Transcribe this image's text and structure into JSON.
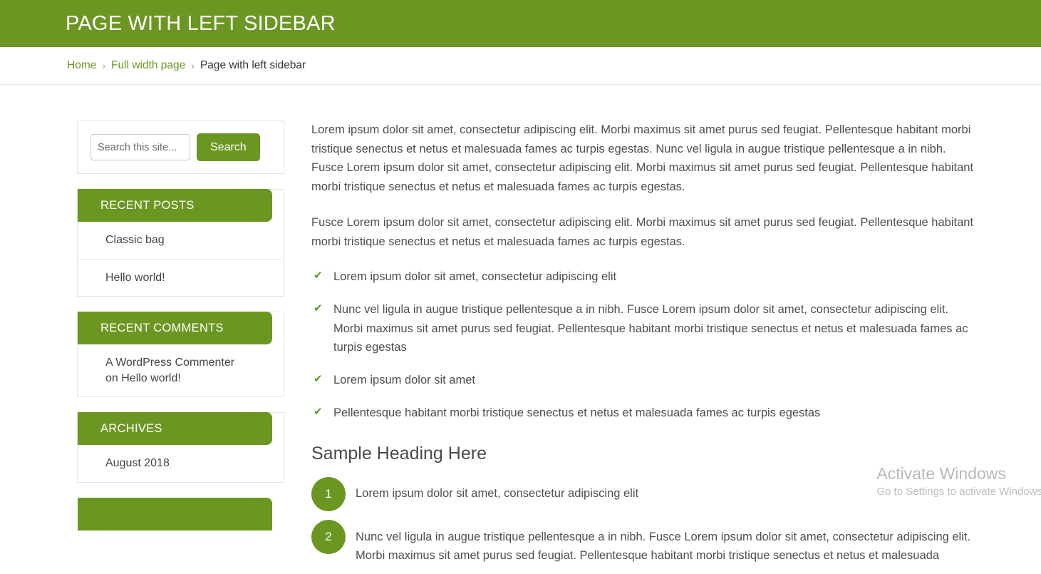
{
  "header": {
    "title": "Page with left sidebar"
  },
  "breadcrumb": {
    "items": [
      {
        "label": "Home",
        "type": "link"
      },
      {
        "label": "Full width page",
        "type": "link"
      },
      {
        "label": "Page with left sidebar",
        "type": "current"
      }
    ],
    "separator": "›"
  },
  "sidebar": {
    "search": {
      "placeholder": "Search this site...",
      "value": "",
      "button_label": "Search"
    },
    "widgets": [
      {
        "title": "Recent Posts",
        "items": [
          "Classic bag",
          "Hello world!"
        ]
      },
      {
        "title": "Recent Comments",
        "items": [
          "A WordPress Commenter",
          "on Hello world!"
        ]
      },
      {
        "title": "Archives",
        "items": [
          "August 2018"
        ]
      }
    ]
  },
  "main": {
    "paragraphs": [
      "Lorem ipsum dolor sit amet, consectetur adipiscing elit. Morbi maximus sit amet purus sed feugiat. Pellentesque habitant morbi tristique senectus et netus et malesuada fames ac turpis egestas. Nunc vel ligula in augue tristique pellentesque a in nibh. Fusce Lorem ipsum dolor sit amet, consectetur adipiscing elit. Morbi maximus sit amet purus sed feugiat. Pellentesque habitant morbi tristique senectus et netus et malesuada fames ac turpis egestas.",
      "Fusce Lorem ipsum dolor sit amet, consectetur adipiscing elit. Morbi maximus sit amet purus sed feugiat. Pellentesque habitant morbi tristique senectus et netus et malesuada fames ac turpis egestas."
    ],
    "check_icon": "✔",
    "check_list": [
      "Lorem ipsum dolor sit amet, consectetur adipiscing elit",
      "Nunc vel ligula in augue tristique pellentesque a in nibh. Fusce Lorem ipsum dolor sit amet, consectetur adipiscing elit. Morbi maximus sit amet purus sed feugiat. Pellentesque habitant morbi tristique senectus et netus et malesuada fames ac turpis egestas",
      "Lorem ipsum dolor sit amet",
      "Pellentesque habitant morbi tristique senectus et netus et malesuada fames ac turpis egestas"
    ],
    "section_heading": "Sample Heading Here",
    "numbered_list": [
      {
        "number": "1",
        "text": "Lorem ipsum dolor sit amet, consectetur adipiscing elit"
      },
      {
        "number": "2",
        "text": "Nunc vel ligula in augue tristique pellentesque a in nibh. Fusce Lorem ipsum dolor sit amet, consectetur adipiscing elit. Morbi maximus sit amet purus sed feugiat. Pellentesque habitant morbi tristique senectus et netus et malesuada"
      }
    ]
  },
  "watermark": {
    "title": "Activate Windows",
    "subtitle": "Go to Settings to activate Windows"
  },
  "colors": {
    "brand_green": "#6c9622",
    "link_green": "#6c9622",
    "text": "#4e4e4e",
    "border": "#e6e6e6"
  }
}
